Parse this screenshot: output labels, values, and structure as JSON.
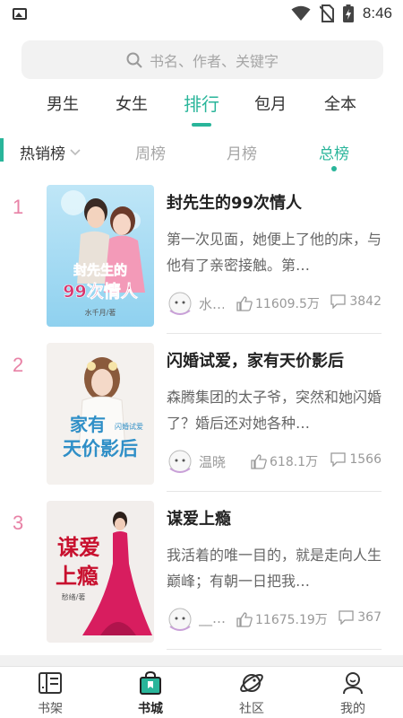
{
  "status_bar": {
    "time": "8:46"
  },
  "search": {
    "placeholder": "书名、作者、关键字"
  },
  "tabs": [
    {
      "label": "男生",
      "active": false
    },
    {
      "label": "女生",
      "active": false
    },
    {
      "label": "排行",
      "active": true
    },
    {
      "label": "包月",
      "active": false
    },
    {
      "label": "全本",
      "active": false
    }
  ],
  "ranking": {
    "category": "热销榜",
    "periods": [
      {
        "label": "周榜",
        "active": false
      },
      {
        "label": "月榜",
        "active": false
      },
      {
        "label": "总榜",
        "active": true
      }
    ]
  },
  "books": [
    {
      "rank": "1",
      "title": "封先生的99次情人",
      "description": "第一次见面，她便上了他的床，与他有了亲密接触。第…",
      "author": "水…",
      "likes": "11609.5万",
      "comments": "3842",
      "cover_text": [
        "封先生的",
        "99次情人"
      ],
      "cover_author": "水千月/著"
    },
    {
      "rank": "2",
      "title": "闪婚试爱，家有天价影后",
      "description": "森腾集团的太子爷，突然和她闪婚了？婚后还对她各种…",
      "author": "温晓",
      "likes": "618.1万",
      "comments": "1566",
      "cover_text": [
        "家有",
        "天价影后"
      ],
      "cover_author": "闪婚试爱"
    },
    {
      "rank": "3",
      "title": "谋爱上瘾",
      "description": "我活着的唯一目的，就是走向人生巅峰；有朝一日把我…",
      "author": "__…",
      "likes": "11675.19万",
      "comments": "367",
      "cover_text": [
        "谋爱",
        "上瘾"
      ],
      "cover_author": "愁绪/著"
    }
  ],
  "bottom_nav": [
    {
      "label": "书架",
      "icon": "bookshelf-icon",
      "active": false
    },
    {
      "label": "书城",
      "icon": "bookstore-bag-icon",
      "active": true
    },
    {
      "label": "社区",
      "icon": "community-planet-icon",
      "active": false
    },
    {
      "label": "我的",
      "icon": "profile-icon",
      "active": false
    }
  ],
  "colors": {
    "accent": "#29b59a",
    "rank": "#e882a6"
  }
}
